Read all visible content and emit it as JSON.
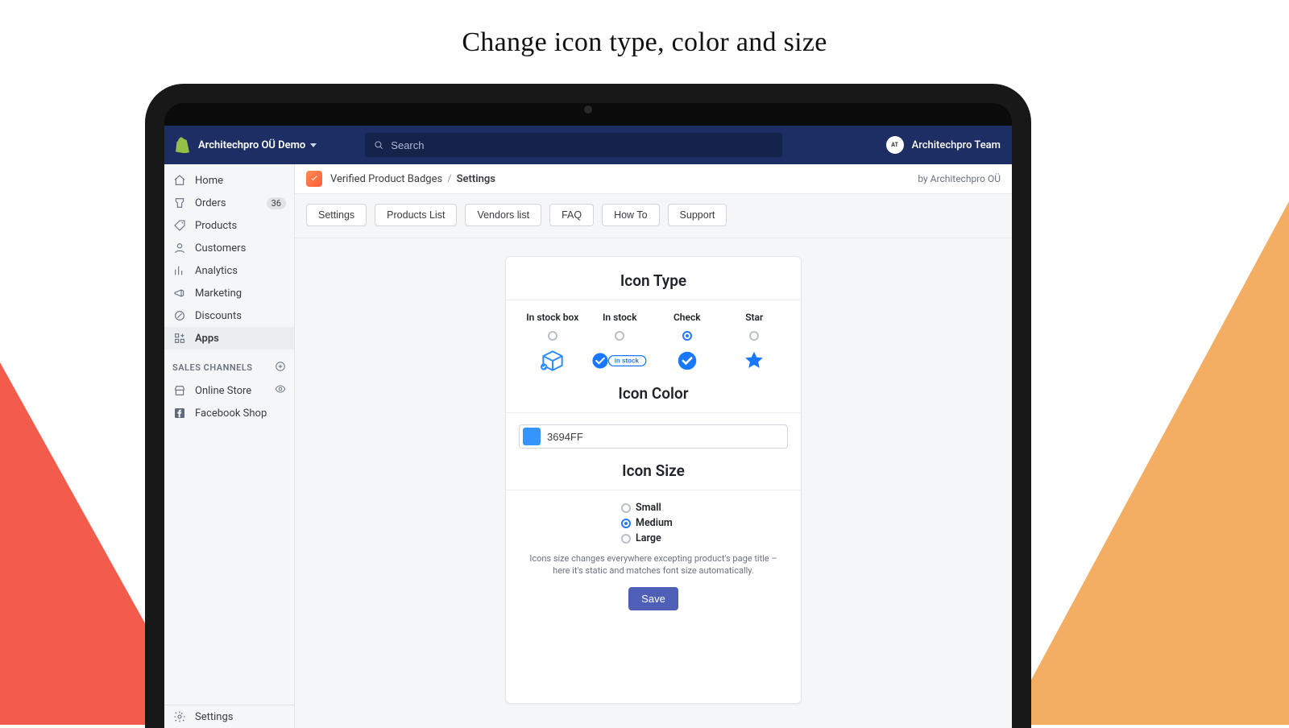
{
  "headline": "Change icon type, color and size",
  "topbar": {
    "store_name": "Architechpro OÜ Demo",
    "search_placeholder": "Search",
    "team_name": "Architechpro Team"
  },
  "sidebar": {
    "items": [
      {
        "id": "home",
        "label": "Home"
      },
      {
        "id": "orders",
        "label": "Orders",
        "badge": "36"
      },
      {
        "id": "products",
        "label": "Products"
      },
      {
        "id": "customers",
        "label": "Customers"
      },
      {
        "id": "analytics",
        "label": "Analytics"
      },
      {
        "id": "marketing",
        "label": "Marketing"
      },
      {
        "id": "discounts",
        "label": "Discounts"
      },
      {
        "id": "apps",
        "label": "Apps",
        "active": true
      }
    ],
    "channels_heading": "SALES CHANNELS",
    "channels": [
      {
        "id": "online-store",
        "label": "Online Store"
      },
      {
        "id": "facebook-shop",
        "label": "Facebook Shop"
      }
    ],
    "footer_label": "Settings"
  },
  "breadcrumb": {
    "app_name": "Verified Product Badges",
    "current": "Settings",
    "byline": "by Architechpro OÜ"
  },
  "tabs": [
    "Settings",
    "Products List",
    "Vendors list",
    "FAQ",
    "How To",
    "Support"
  ],
  "card": {
    "icon_type_heading": "Icon Type",
    "icon_type_options": [
      {
        "id": "in-stock-box",
        "label": "In stock box"
      },
      {
        "id": "in-stock",
        "label": "In stock",
        "pill": "in stock"
      },
      {
        "id": "check",
        "label": "Check",
        "selected": true
      },
      {
        "id": "star",
        "label": "Star"
      }
    ],
    "icon_color_heading": "Icon Color",
    "icon_color_value": "3694FF",
    "icon_size_heading": "Icon Size",
    "icon_size_options": [
      {
        "id": "small",
        "label": "Small"
      },
      {
        "id": "medium",
        "label": "Medium",
        "selected": true
      },
      {
        "id": "large",
        "label": "Large"
      }
    ],
    "hint": "Icons size changes everywhere excepting product's page title – here it's static and matches font size automatically.",
    "save_label": "Save"
  }
}
